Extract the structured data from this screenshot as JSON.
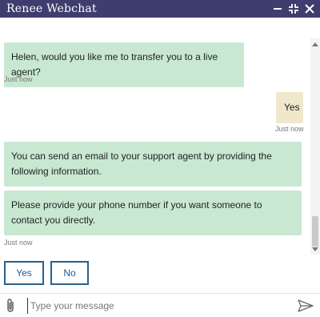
{
  "window": {
    "title": "Renee Webchat"
  },
  "titlebar_icons": [
    "minimize-icon",
    "collapse-icon",
    "close-icon"
  ],
  "messages": [
    {
      "from": "bot",
      "text": "Helen, would you like me to transfer you to a live agent?",
      "time": "Just now"
    },
    {
      "from": "user",
      "text": "Yes",
      "time": "Just now"
    },
    {
      "from": "bot",
      "text": "You can send an email to your support agent by providing the following information."
    },
    {
      "from": "bot",
      "text": "Please provide your phone number if you want someone to contact you directly.",
      "time": "Just now"
    }
  ],
  "quick_replies": [
    "Yes",
    "No"
  ],
  "composer": {
    "placeholder": "Type your message",
    "value": ""
  },
  "colors": {
    "titlebar": "#3f3d6e",
    "bot_bubble": "#c8e8d2",
    "user_bubble": "#f0e8cc",
    "button_border": "#2c5f8a"
  }
}
